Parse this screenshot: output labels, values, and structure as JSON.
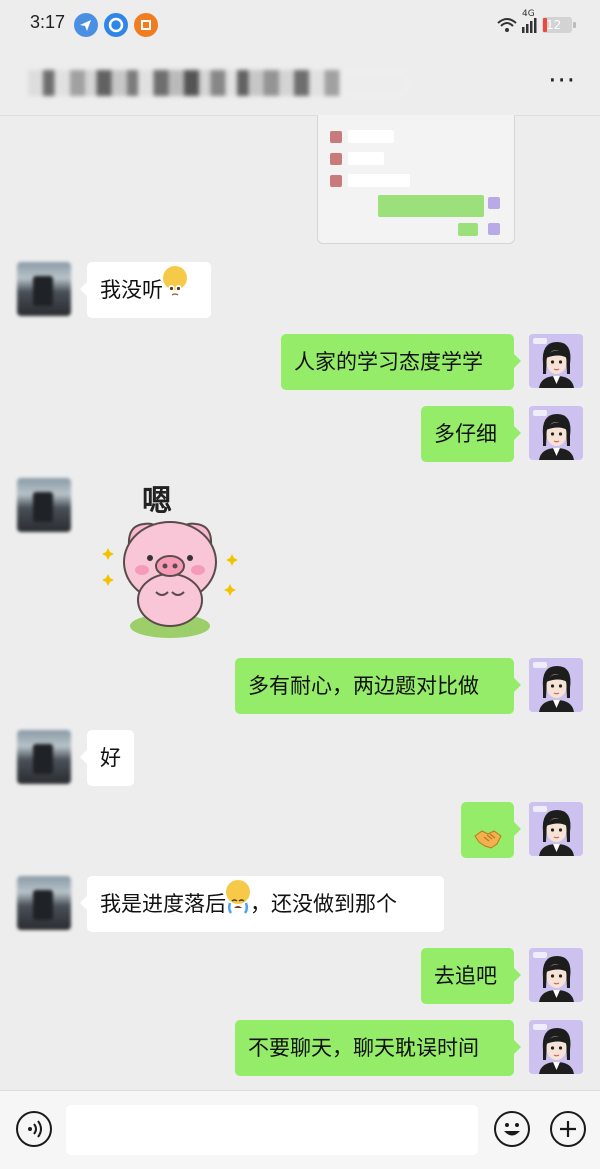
{
  "status_bar": {
    "time": "3:17",
    "network": "4G",
    "battery": "12"
  },
  "header": {
    "more_label": "···"
  },
  "messages": [
    {
      "side": "left",
      "text": "我没听",
      "emoji": "pleading-face"
    },
    {
      "side": "right",
      "text": "人家的学习态度学学"
    },
    {
      "side": "right",
      "text": "多仔细"
    },
    {
      "side": "left",
      "type": "sticker",
      "sticker_text": "嗯",
      "sticker": "pink-pig-sticker"
    },
    {
      "side": "right",
      "text": "多有耐心，两边题对比做"
    },
    {
      "side": "left",
      "text": "好"
    },
    {
      "side": "right",
      "type": "emoji",
      "emoji": "handshake"
    },
    {
      "side": "left",
      "text_before": "我是进度落后",
      "text_after": "，还没做到那个",
      "emoji": "crying-face"
    },
    {
      "side": "right",
      "text": "去追吧"
    },
    {
      "side": "right",
      "text": "不要聊天，聊天耽误时间"
    }
  ],
  "input": {
    "placeholder": ""
  },
  "colors": {
    "background": "#ededed",
    "bubble_sent": "#95ec69",
    "bubble_received": "#ffffff"
  }
}
